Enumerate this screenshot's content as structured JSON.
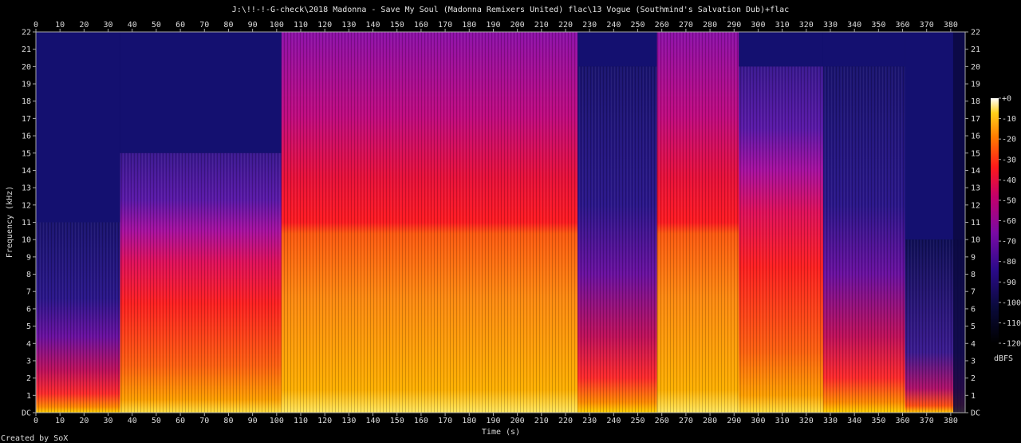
{
  "chart_data": {
    "type": "heatmap",
    "title": "J:\\!!-!-G-check\\2018 Madonna - Save My Soul (Madonna Remixers United) flac\\13 Vogue (Southmind's Salvation Dub)+flac",
    "xlabel": "Time (s)",
    "ylabel": "Frequency (kHz)",
    "xlim": [
      0,
      386
    ],
    "ylim": [
      0,
      22
    ],
    "x_ticks": [
      0,
      10,
      20,
      30,
      40,
      50,
      60,
      70,
      80,
      90,
      100,
      110,
      120,
      130,
      140,
      150,
      160,
      170,
      180,
      190,
      200,
      210,
      220,
      230,
      240,
      250,
      260,
      270,
      280,
      290,
      300,
      310,
      320,
      330,
      340,
      350,
      360,
      370,
      380
    ],
    "y_ticks": [
      "DC",
      "1",
      "2",
      "3",
      "4",
      "5",
      "6",
      "7",
      "8",
      "9",
      "10",
      "11",
      "12",
      "13",
      "14",
      "15",
      "16",
      "17",
      "18",
      "19",
      "20",
      "21",
      "22"
    ],
    "colorbar": {
      "label": "dBFS",
      "ticks": [
        "+0",
        "-10",
        "-20",
        "-30",
        "-40",
        "-50",
        "-60",
        "-70",
        "-80",
        "-90",
        "-100",
        "-110",
        "-120"
      ],
      "range_db": [
        -120,
        0
      ]
    },
    "segments": [
      {
        "t_start": 0,
        "t_end": 35,
        "level": "quiet",
        "cutoff_khz": 11
      },
      {
        "t_start": 35,
        "t_end": 102,
        "level": "medium",
        "cutoff_khz": 15
      },
      {
        "t_start": 102,
        "t_end": 225,
        "level": "loud",
        "cutoff_khz": 22
      },
      {
        "t_start": 225,
        "t_end": 258,
        "level": "quiet",
        "cutoff_khz": 20
      },
      {
        "t_start": 258,
        "t_end": 292,
        "level": "loud",
        "cutoff_khz": 22
      },
      {
        "t_start": 292,
        "t_end": 327,
        "level": "medium",
        "cutoff_khz": 20
      },
      {
        "t_start": 327,
        "t_end": 361,
        "level": "quiet",
        "cutoff_khz": 20
      },
      {
        "t_start": 361,
        "t_end": 386,
        "level": "fade",
        "cutoff_khz": 10
      }
    ],
    "footer": "Created by SoX"
  }
}
